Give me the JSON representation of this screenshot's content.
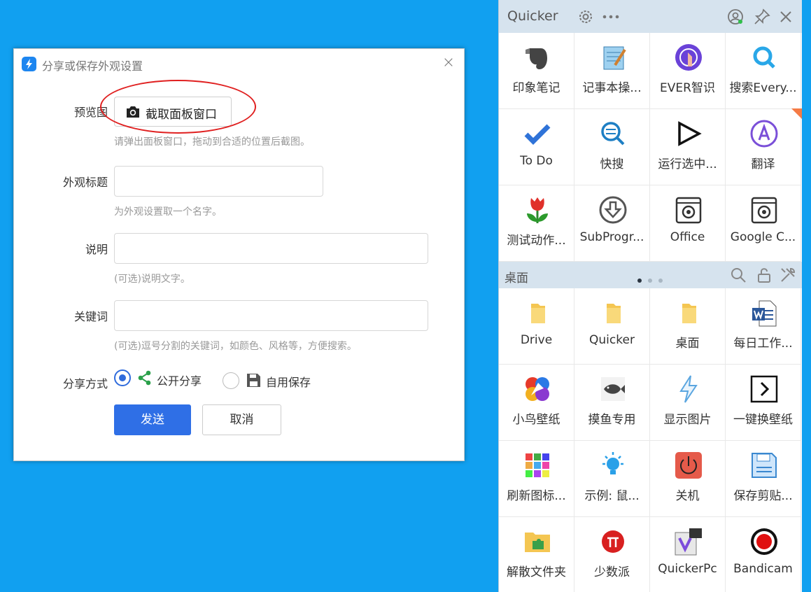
{
  "dialog": {
    "title": "分享或保存外观设置",
    "close_glyph": "×",
    "preview_label": "预览图",
    "capture_button": "截取面板窗口",
    "preview_hint": "请弹出面板窗口，拖动到合适的位置后截图。",
    "title_label": "外观标题",
    "title_value": "",
    "title_hint": "为外观设置取一个名字。",
    "desc_label": "说明",
    "desc_value": "",
    "desc_hint": "(可选)说明文字。",
    "keywords_label": "关键词",
    "keywords_value": "",
    "keywords_hint": "(可选)逗号分割的关键词，如颜色、风格等，方便搜索。",
    "share_mode_label": "分享方式",
    "share_public": "公开分享",
    "share_private": "自用保存",
    "send_button": "发送",
    "cancel_button": "取消"
  },
  "panel": {
    "title": "Quicker",
    "section_title": "桌面",
    "top_items": [
      {
        "label": "印象笔记",
        "icon": "evernote-icon"
      },
      {
        "label": "记事本操...",
        "icon": "notepad-icon"
      },
      {
        "label": "EVER智识",
        "icon": "ever-icon"
      },
      {
        "label": "搜索Every...",
        "icon": "everything-search-icon"
      },
      {
        "label": "To Do",
        "icon": "todo-check-icon"
      },
      {
        "label": "快搜",
        "icon": "quick-search-icon"
      },
      {
        "label": "运行选中...",
        "icon": "play-icon"
      },
      {
        "label": "翻译",
        "icon": "translate-icon"
      },
      {
        "label": "测试动作...",
        "icon": "tulip-icon"
      },
      {
        "label": "SubProgr...",
        "icon": "download-circle-icon"
      },
      {
        "label": "Office",
        "icon": "office-box-icon"
      },
      {
        "label": "Google C...",
        "icon": "google-box-icon"
      }
    ],
    "bottom_items": [
      {
        "label": "Drive",
        "icon": "folder-icon"
      },
      {
        "label": "Quicker",
        "icon": "folder-icon"
      },
      {
        "label": "桌面",
        "icon": "folder-icon"
      },
      {
        "label": "每日工作...",
        "icon": "word-doc-icon"
      },
      {
        "label": "小鸟壁纸",
        "icon": "bird-icon"
      },
      {
        "label": "摸鱼专用",
        "icon": "fish-icon"
      },
      {
        "label": "显示图片",
        "icon": "lightning-icon"
      },
      {
        "label": "一键换壁纸",
        "icon": "chevron-right-box-icon"
      },
      {
        "label": "刷新图标...",
        "icon": "icon-grid-icon"
      },
      {
        "label": "示例: 鼠...",
        "icon": "bulb-icon"
      },
      {
        "label": "关机",
        "icon": "power-icon"
      },
      {
        "label": "保存剪贴...",
        "icon": "floppy-icon"
      },
      {
        "label": "解散文件夹",
        "icon": "puzzle-folder-icon"
      },
      {
        "label": "少数派",
        "icon": "pi-icon"
      },
      {
        "label": "QuickerPc",
        "icon": "vs-icon"
      },
      {
        "label": "Bandicam",
        "icon": "record-icon"
      }
    ],
    "colors": {
      "accent": "#2f6fe6",
      "header_bg": "#d6e3ee",
      "desktop_bg": "#11a0f0"
    }
  }
}
